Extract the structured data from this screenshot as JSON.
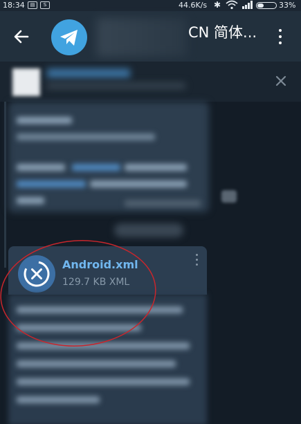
{
  "status_bar": {
    "time": "18:34",
    "indicator_1": "▤",
    "indicator_2": "S",
    "net_speed": "44.6K/s",
    "battery_pct": "33%",
    "battery_level": 0.33
  },
  "header": {
    "title_visible": "CN 简体..."
  },
  "file_message": {
    "file_name": "Android.xml",
    "file_meta": "129.7 KB XML"
  },
  "colors": {
    "header_bg": "#22303d",
    "chat_bg": "#131c26",
    "link_blue": "#71b7ef",
    "avatar_blue": "#41a3e0",
    "annotation_red": "#c8262c"
  }
}
